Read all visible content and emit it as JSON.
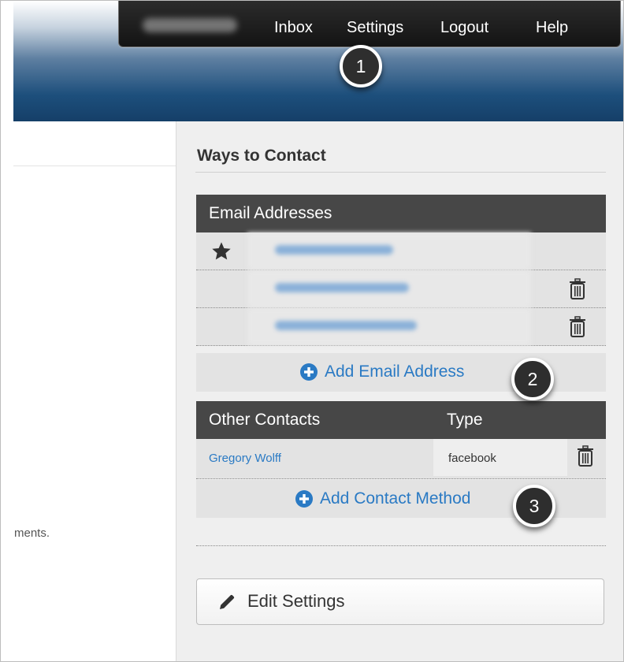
{
  "nav": {
    "inbox": "Inbox",
    "settings": "Settings",
    "logout": "Logout",
    "help": "Help"
  },
  "callouts": [
    "1",
    "2",
    "3"
  ],
  "left": {
    "text": "ments."
  },
  "contact": {
    "title": "Ways to Contact",
    "email_header": "Email Addresses",
    "add_email": "Add Email Address",
    "other_header": "Other Contacts",
    "type_header": "Type",
    "contacts": [
      {
        "name": "Gregory Wolff",
        "type": "facebook"
      }
    ],
    "add_contact": "Add Contact Method",
    "edit_button": "Edit Settings"
  },
  "colors": {
    "link": "#2a7ac4",
    "header_dark": "#474747",
    "nav_bg": "#1a1a1a"
  },
  "icons": [
    "star-icon",
    "trash-icon",
    "plus-circle-icon",
    "pencil-icon"
  ]
}
